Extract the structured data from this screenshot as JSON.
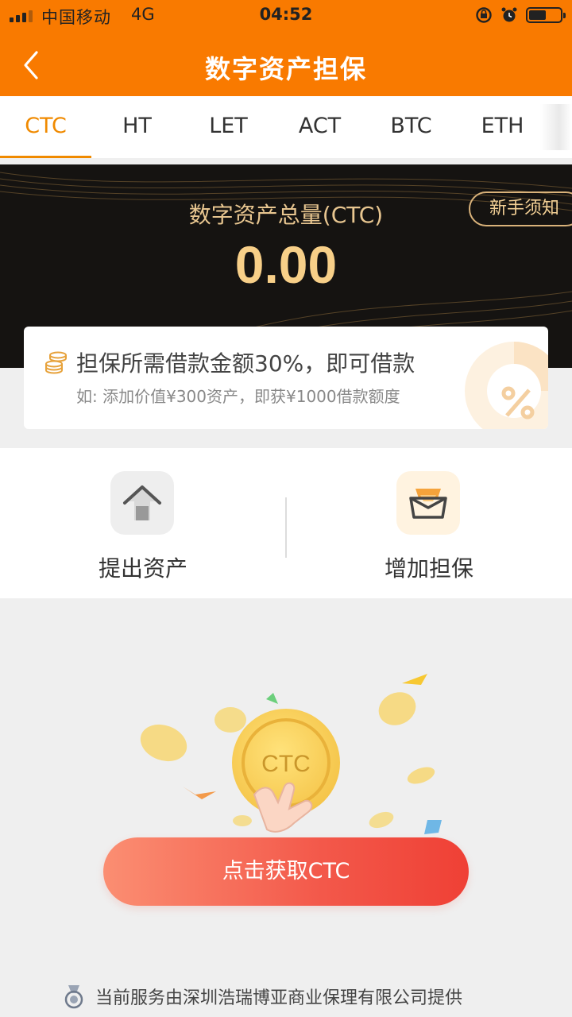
{
  "status_bar": {
    "carrier": "中国移动",
    "network": "4G",
    "time": "04:52",
    "battery_level": 0.55
  },
  "nav": {
    "title": "数字资产担保"
  },
  "tabs": {
    "items": [
      "CTC",
      "HT",
      "LET",
      "ACT",
      "BTC",
      "ETH"
    ],
    "active": "CTC"
  },
  "banner": {
    "label": "数字资产总量(CTC)",
    "value": "0.00",
    "guide_button": "新手须知"
  },
  "info_card": {
    "title": "担保所需借款金额30%，即可借款",
    "subtitle": "如: 添加价值¥300资产，即获¥1000借款额度"
  },
  "actions": {
    "withdraw_label": "提出资产",
    "add_label": "增加担保"
  },
  "illustration": {
    "coin_text": "CTC"
  },
  "cta": {
    "label": "点击获取CTC"
  },
  "footer": {
    "text": "当前服务由深圳浩瑞博亚商业保理有限公司提供"
  },
  "colors": {
    "brand_orange": "#f97a00",
    "tab_active": "#f08a00",
    "gold": "#f7cf88",
    "cta_red": "#ef4035"
  }
}
